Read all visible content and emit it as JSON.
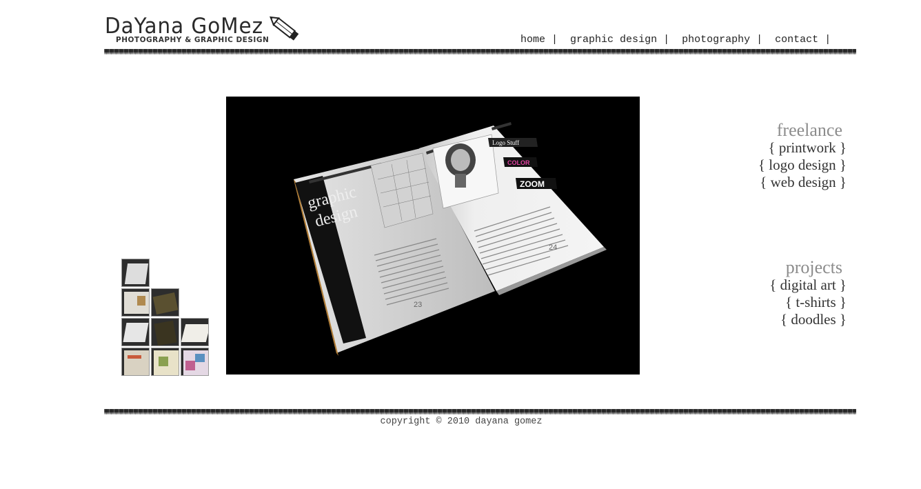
{
  "header": {
    "logo_title": "DaYana GoMez",
    "logo_subtitle": "Photography & Graphic Design"
  },
  "nav": {
    "items": [
      "home",
      "graphic design",
      "photography",
      "contact"
    ],
    "separator": "|"
  },
  "main_image": {
    "left_page_heading_line1": "graphic",
    "left_page_heading_line2": "design",
    "left_page_number": "23",
    "right_page_number": "24",
    "right_page_tag1": "Logo Stuff",
    "right_page_tag2": "COLOR",
    "right_page_tag3": "ZOOM"
  },
  "freelance": {
    "heading": "freelance",
    "items": [
      "{ printwork }",
      "{ logo design }",
      "{ web design }"
    ]
  },
  "projects": {
    "heading": "projects",
    "items": [
      "{ digital art }",
      "{ t-shirts }",
      "{ doodles }"
    ]
  },
  "footer": {
    "copyright": "copyright © 2010 dayana gomez"
  },
  "colors": {
    "menu_heading": "#8c8c8c",
    "text": "#333333",
    "rule": "#2a2a2a",
    "image_bg": "#000000"
  }
}
